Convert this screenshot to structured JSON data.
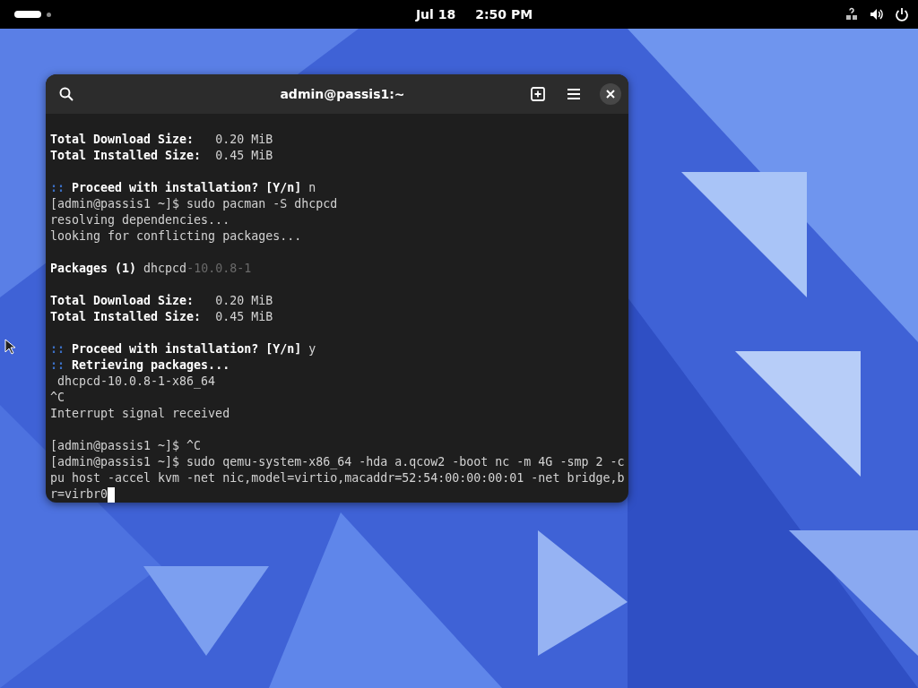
{
  "top_bar": {
    "date": "Jul 18",
    "time": "2:50 PM"
  },
  "window": {
    "title": "admin@passis1:~"
  },
  "terminal": {
    "cursor": true,
    "lines": [
      {
        "kind": "text",
        "segments": [
          {
            "text": "Total Download Size:",
            "kind": "bold"
          },
          {
            "text": "   0.20 MiB",
            "kind": "normal"
          }
        ]
      },
      {
        "kind": "text",
        "segments": [
          {
            "text": "Total Installed Size:",
            "kind": "bold"
          },
          {
            "text": "  0.45 MiB",
            "kind": "normal"
          }
        ]
      },
      {
        "kind": "blank"
      },
      {
        "kind": "text",
        "segments": [
          {
            "text": "::",
            "kind": "marker"
          },
          {
            "text": " Proceed with installation? [Y/n]",
            "kind": "bold"
          },
          {
            "text": " n",
            "kind": "normal"
          }
        ]
      },
      {
        "kind": "text",
        "segments": [
          {
            "text": "[admin@passis1 ~]$ sudo pacman -S dhcpcd",
            "kind": "normal"
          }
        ]
      },
      {
        "kind": "text",
        "segments": [
          {
            "text": "resolving dependencies...",
            "kind": "normal"
          }
        ]
      },
      {
        "kind": "text",
        "segments": [
          {
            "text": "looking for conflicting packages...",
            "kind": "normal"
          }
        ]
      },
      {
        "kind": "blank"
      },
      {
        "kind": "text",
        "segments": [
          {
            "text": "Packages (1)",
            "kind": "bold"
          },
          {
            "text": " dhcpcd",
            "kind": "normal"
          },
          {
            "text": "-10.0.8-1",
            "kind": "dim"
          }
        ]
      },
      {
        "kind": "blank"
      },
      {
        "kind": "text",
        "segments": [
          {
            "text": "Total Download Size:",
            "kind": "bold"
          },
          {
            "text": "   0.20 MiB",
            "kind": "normal"
          }
        ]
      },
      {
        "kind": "text",
        "segments": [
          {
            "text": "Total Installed Size:",
            "kind": "bold"
          },
          {
            "text": "  0.45 MiB",
            "kind": "normal"
          }
        ]
      },
      {
        "kind": "blank"
      },
      {
        "kind": "text",
        "segments": [
          {
            "text": "::",
            "kind": "marker"
          },
          {
            "text": " Proceed with installation? [Y/n]",
            "kind": "bold"
          },
          {
            "text": " y",
            "kind": "normal"
          }
        ]
      },
      {
        "kind": "text",
        "segments": [
          {
            "text": "::",
            "kind": "marker"
          },
          {
            "text": " Retrieving packages...",
            "kind": "bold"
          }
        ]
      },
      {
        "kind": "text",
        "segments": [
          {
            "text": " dhcpcd-10.0.8-1-x86_64",
            "kind": "normal"
          }
        ]
      },
      {
        "kind": "text",
        "segments": [
          {
            "text": "^C",
            "kind": "normal"
          }
        ]
      },
      {
        "kind": "text",
        "segments": [
          {
            "text": "Interrupt signal received",
            "kind": "normal"
          }
        ]
      },
      {
        "kind": "blank"
      },
      {
        "kind": "text",
        "segments": [
          {
            "text": "[admin@passis1 ~]$ ^C",
            "kind": "normal"
          }
        ]
      },
      {
        "kind": "text",
        "segments": [
          {
            "text": "[admin@passis1 ~]$ sudo qemu-system-x86_64 -hda a.qcow2 -boot nc -m 4G -smp 2 -c",
            "kind": "normal"
          }
        ]
      },
      {
        "kind": "text",
        "segments": [
          {
            "text": "pu host -accel kvm -net nic,model=virtio,macaddr=52:54:00:00:00:01 -net bridge,b",
            "kind": "normal"
          }
        ]
      },
      {
        "kind": "text",
        "segments": [
          {
            "text": "r=virbr0",
            "kind": "normal"
          }
        ]
      }
    ]
  }
}
